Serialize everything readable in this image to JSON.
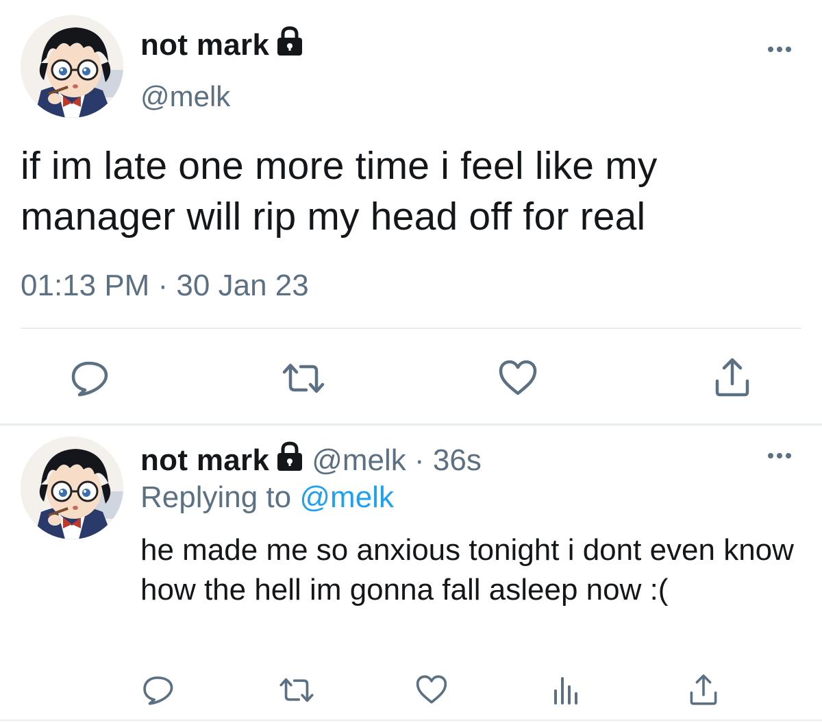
{
  "main_tweet": {
    "author_name": "not mark",
    "handle": "@melk",
    "text": "if im late one more time i feel like my manager will rip my head off for real",
    "timestamp": "01:13 PM · 30 Jan 23",
    "avatar_icon": "anime-avatar-icon",
    "protected_icon": "lock-icon",
    "actions": [
      "reply-icon",
      "retweet-icon",
      "like-icon",
      "share-icon"
    ]
  },
  "reply_tweet": {
    "author_name": "not mark",
    "handle_time": "@melk · 36s",
    "replying_prefix": "Replying to",
    "replying_handle": "@melk",
    "text": "he made me so anxious tonight i dont even know how the hell im gonna fall asleep now :(",
    "avatar_icon": "anime-avatar-icon",
    "protected_icon": "lock-icon",
    "actions": [
      "reply-icon",
      "retweet-icon",
      "like-icon",
      "analytics-icon",
      "share-icon"
    ]
  },
  "colors": {
    "text_primary": "#14171a",
    "text_secondary": "#5b7083",
    "link": "#1da1f2",
    "divider": "#e6ecf0",
    "icon": "#5b7083"
  }
}
